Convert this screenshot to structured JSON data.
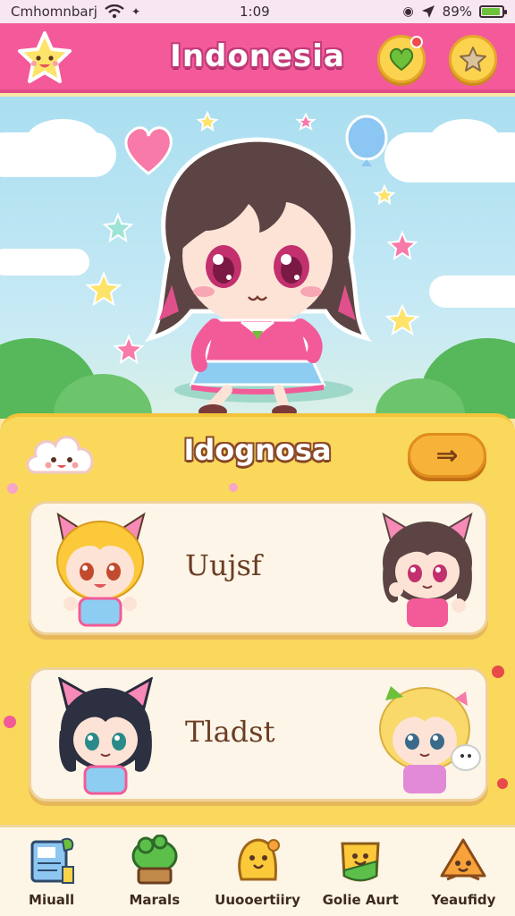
{
  "status_bar": {
    "carrier": "Cmhomnbarj",
    "time": "1:09",
    "battery_percent": "89%",
    "battery_level": 0.89,
    "icons": [
      "wifi-icon",
      "location-arrow-icon",
      "battery-icon"
    ]
  },
  "header": {
    "title": "Indonesia",
    "left_icon": "smiling-star-icon",
    "right_icons": [
      "heart-icon",
      "star-icon"
    ]
  },
  "hero": {
    "character": "anime-girl-brown-hair-pink-dress",
    "decorations": [
      "heart-balloon",
      "blue-balloon",
      "stars",
      "clouds",
      "bushes"
    ]
  },
  "panel": {
    "title": "Idognosa",
    "mascot": "cloud-face-icon",
    "action_icon": "arrow-right-icon",
    "action_label": "⇒",
    "cards": [
      {
        "name": "Uujsf",
        "left_character": "blonde-cat-girl",
        "right_character": "brunette-cat-girl"
      },
      {
        "name": "Tladst",
        "left_character": "black-hair-cat-girl",
        "right_character": "blonde-girl-with-pets"
      }
    ]
  },
  "bottom_nav": {
    "items": [
      {
        "label": "Miuall",
        "icon": "document-icon"
      },
      {
        "label": "Marals",
        "icon": "tree-icon"
      },
      {
        "label": "Uuooertiiry",
        "icon": "blob-mascot-icon"
      },
      {
        "label": "Golie Aurt",
        "icon": "bag-icon"
      },
      {
        "label": "Yeaufidy",
        "icon": "slice-mascot-icon"
      }
    ]
  },
  "colors": {
    "header_pink": "#f45a9a",
    "panel_yellow": "#f9d85c",
    "card_cream": "#fdf6e8",
    "accent_orange": "#f7b23a"
  }
}
